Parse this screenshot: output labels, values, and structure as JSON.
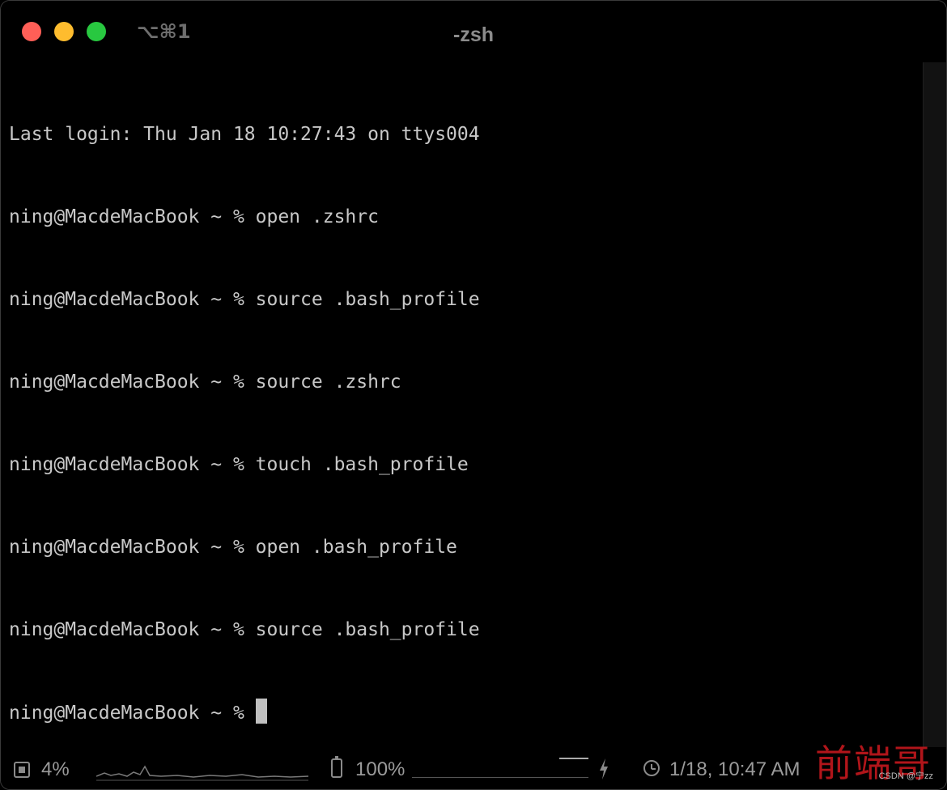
{
  "window": {
    "title": "-zsh",
    "shortcut": "⌥⌘1"
  },
  "terminal": {
    "lines": [
      "Last login: Thu Jan 18 10:27:43 on ttys004",
      "ning@MacdeMacBook ~ % open .zshrc",
      "ning@MacdeMacBook ~ % source .bash_profile",
      "ning@MacdeMacBook ~ % source .zshrc",
      "ning@MacdeMacBook ~ % touch .bash_profile",
      "ning@MacdeMacBook ~ % open .bash_profile",
      "ning@MacdeMacBook ~ % source .bash_profile"
    ],
    "prompt": "ning@MacdeMacBook ~ % "
  },
  "status": {
    "cpu": "4%",
    "battery": "100%",
    "clock": "1/18, 10:47 AM"
  },
  "watermark": {
    "logo": "前端哥",
    "source": "CSDN @宁zz"
  },
  "colors": {
    "close": "#ff5f57",
    "minimize": "#febc2e",
    "zoom": "#28c840",
    "text": "#c8c8c8",
    "watermark": "#b0151a"
  },
  "icons": [
    "cpu-icon",
    "battery-icon",
    "bolt-icon",
    "clock-icon"
  ]
}
